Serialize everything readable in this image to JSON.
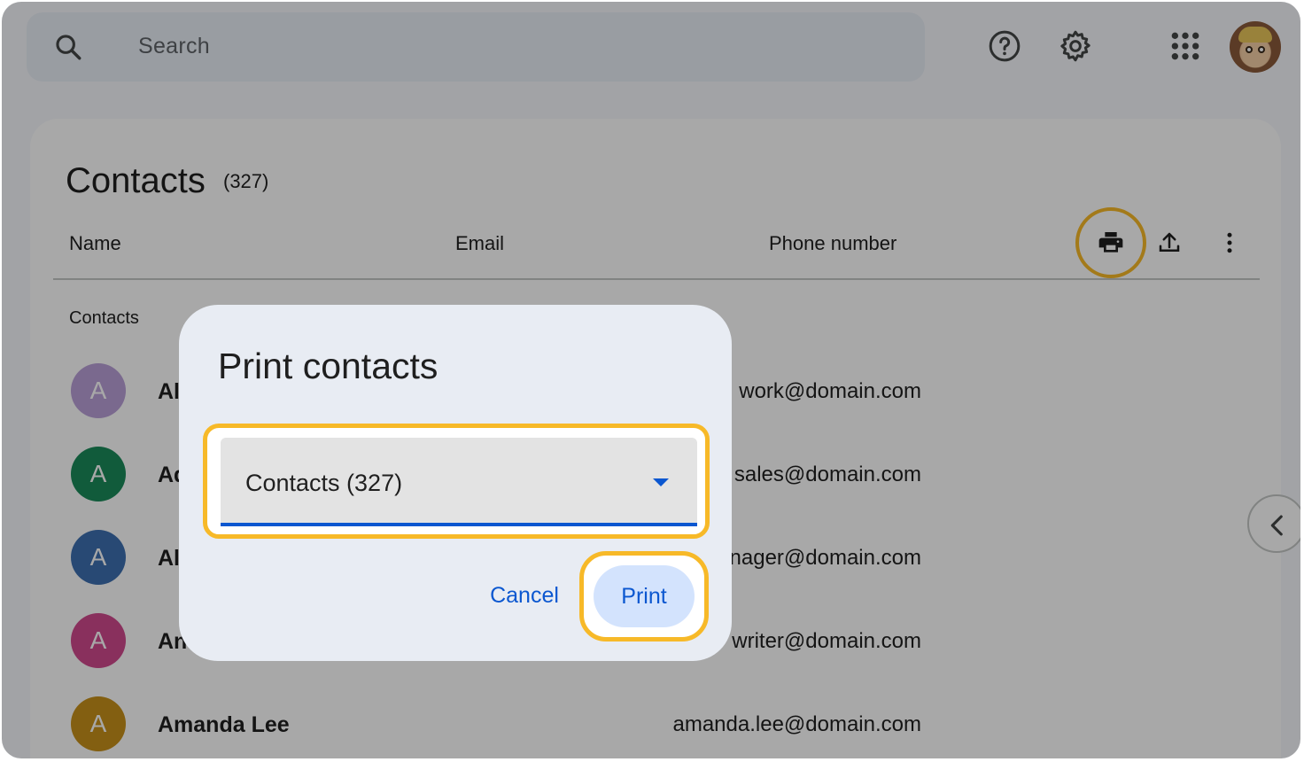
{
  "search": {
    "placeholder": "Search"
  },
  "topbar": {
    "help_icon": "help-circle-icon",
    "settings_icon": "gear-icon",
    "apps_icon": "apps-grid-icon",
    "account_icon": "account-avatar"
  },
  "page": {
    "title": "Contacts",
    "count": "(327)",
    "columns": [
      "Name",
      "Email",
      "Phone number"
    ],
    "section_label": "Contacts"
  },
  "toolbar": {
    "print_icon": "printer-icon",
    "export_icon": "upload-icon",
    "more_icon": "more-vert-icon"
  },
  "contacts": [
    {
      "initial": "A",
      "name": "Al",
      "email": "work@domain.com",
      "color": "#b9a0d8"
    },
    {
      "initial": "A",
      "name": "Ad",
      "email": "sales@domain.com",
      "color": "#1b8a5a"
    },
    {
      "initial": "A",
      "name": "Al",
      "email": "manager@domain.com",
      "color": "#3d6fb0"
    },
    {
      "initial": "A",
      "name": "An",
      "email": "writer@domain.com",
      "color": "#d14a8e"
    },
    {
      "initial": "A",
      "name": "Amanda Lee",
      "email": "amanda.lee@domain.com",
      "color": "#c7901b"
    }
  ],
  "dialog": {
    "title": "Print contacts",
    "select_value": "Contacts (327)",
    "cancel_label": "Cancel",
    "print_label": "Print"
  },
  "colors": {
    "accent": "#0b57d0",
    "highlight": "#f7b928",
    "primary_container": "#d3e3fd"
  }
}
